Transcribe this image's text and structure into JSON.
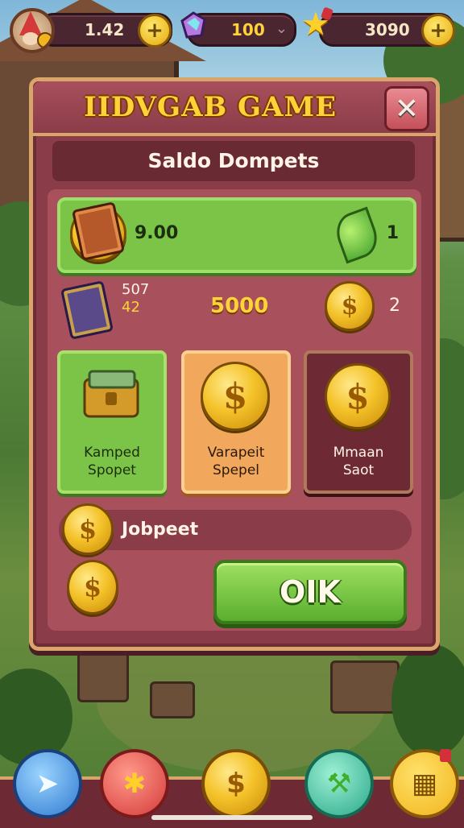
{
  "resources": {
    "hearts_value": "1.42",
    "gems_value": "100",
    "stars_value": "3090"
  },
  "panel": {
    "title": "IIDVGAB GAME",
    "close_label": "✕",
    "subtitle": "Saldo Dompets",
    "row1": {
      "value": "9.00",
      "count": "1"
    },
    "row2": {
      "line1": "507",
      "line2": "42",
      "amount": "5000",
      "count": "2"
    },
    "cards": [
      {
        "line1": "Kamped",
        "line2": "Spopet"
      },
      {
        "line1": "Varapeit",
        "line2": "Spepel"
      },
      {
        "line1": "Mmaan",
        "line2": "Saot"
      }
    ],
    "row3_label": "Jobpeet",
    "ok_label": "OIK"
  },
  "bottom_nav": {
    "items": [
      {
        "icon": "paper-plane-icon",
        "glyph": "➤"
      },
      {
        "icon": "star-burst-icon",
        "glyph": "✱"
      },
      {
        "icon": "dollar-coin-icon",
        "glyph": "$"
      },
      {
        "icon": "hammer-icon",
        "glyph": "⚒"
      },
      {
        "icon": "grid-menu-icon",
        "glyph": "▦"
      }
    ]
  },
  "colors": {
    "panel": "#8a3c48",
    "panel_border": "#d9a56a",
    "title": "#ffd23a",
    "green": "#7bc447",
    "orange": "#f2a85c",
    "coin": "#f4c22a"
  }
}
